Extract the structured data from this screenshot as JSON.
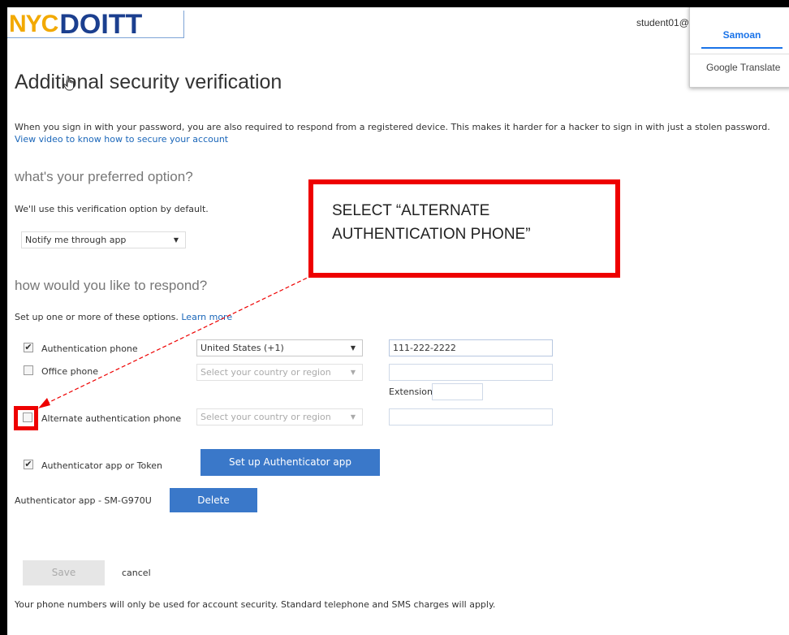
{
  "header": {
    "logo_nyc": "NYC",
    "logo_doitt": "DOITT",
    "user": "student01@"
  },
  "translate": {
    "language": "Samoan",
    "brand": "Google Translate"
  },
  "main": {
    "title_part1": "Additi",
    "title_part2": "nal security verification",
    "intro": "When you sign in with your password, you are also required to respond from a registered device. This makes it harder for a hacker to sign in with just a stolen password.",
    "intro_link": "View video to know how to secure your account",
    "preferred_heading": "what's your preferred option?",
    "preferred_note": "We'll use this verification option by default.",
    "preferred_value": "Notify me through app",
    "respond_heading": "how would you like to respond?",
    "respond_note": "Set up one or more of these options.",
    "learn_more": "Learn more",
    "options": {
      "auth_phone": {
        "label": "Authentication phone",
        "checked": true,
        "country": "United States (+1)",
        "number": "111-222-2222"
      },
      "office_phone": {
        "label": "Office phone",
        "checked": false,
        "country_placeholder": "Select your country or region",
        "extension_label": "Extension"
      },
      "alt_phone": {
        "label": "Alternate authentication phone",
        "checked": false,
        "country_placeholder": "Select your country or region"
      },
      "authenticator": {
        "label": "Authenticator app or Token",
        "checked": true,
        "setup_button": "Set up Authenticator app"
      }
    },
    "device_label": "Authenticator app - SM-G970U",
    "delete_button": "Delete",
    "save_button": "Save",
    "cancel_link": "cancel",
    "footer_note": "Your phone numbers will only be used for account security. Standard telephone and SMS charges will apply."
  },
  "annotation": {
    "callout_text": "SELECT “ALTERNATE AUTHENTICATION PHONE”",
    "color": "#ee0000"
  }
}
